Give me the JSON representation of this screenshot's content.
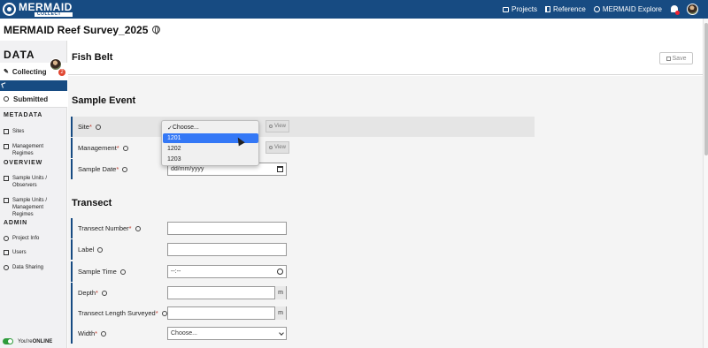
{
  "topbar": {
    "logo_name": "MERMAID",
    "logo_sub": "COLLECT",
    "nav": [
      {
        "label": "Projects",
        "icon": "projects-icon"
      },
      {
        "label": "Reference",
        "icon": "book-icon"
      },
      {
        "label": "MERMAID Explore",
        "icon": "globe-icon"
      }
    ]
  },
  "project": {
    "title": "MERMAID Reef Survey_2025"
  },
  "sidebar": {
    "data_heading": "DATA",
    "collecting": "Collecting",
    "collecting_badge": "2",
    "submitted": "Submitted",
    "metadata_heading": "METADATA",
    "metadata_items": [
      "Sites",
      "Management Regimes"
    ],
    "overview_heading": "OVERVIEW",
    "overview_items": [
      "Sample Units / Observers",
      "Sample Units / Management Regimes"
    ],
    "admin_heading": "ADMIN",
    "admin_items": [
      "Project Info",
      "Users",
      "Data Sharing"
    ],
    "online_prefix": "You're ",
    "online_status": "ONLINE"
  },
  "header": {
    "title": "Fish Belt",
    "save_label": "Save"
  },
  "sample_event": {
    "heading": "Sample Event",
    "site_label": "Site",
    "management_label": "Management",
    "sample_date_label": "Sample Date",
    "sample_date_value": "dd/mm/yyyy",
    "view_label": "View"
  },
  "site_dropdown": {
    "options": [
      "Choose...",
      "1201",
      "1202",
      "1203"
    ],
    "checked_index": 0,
    "highlighted_index": 1
  },
  "transect": {
    "heading": "Transect",
    "transect_number_label": "Transect Number",
    "label_label": "Label",
    "sample_time_label": "Sample Time",
    "sample_time_value": "--:--",
    "depth_label": "Depth",
    "depth_unit": "m",
    "length_label": "Transect Length Surveyed",
    "length_unit": "m",
    "width_label": "Width",
    "width_value": "Choose..."
  },
  "colors": {
    "brand": "#174b82",
    "required": "#c0392b",
    "highlight": "#3478f6",
    "online": "#2d9b3a"
  }
}
